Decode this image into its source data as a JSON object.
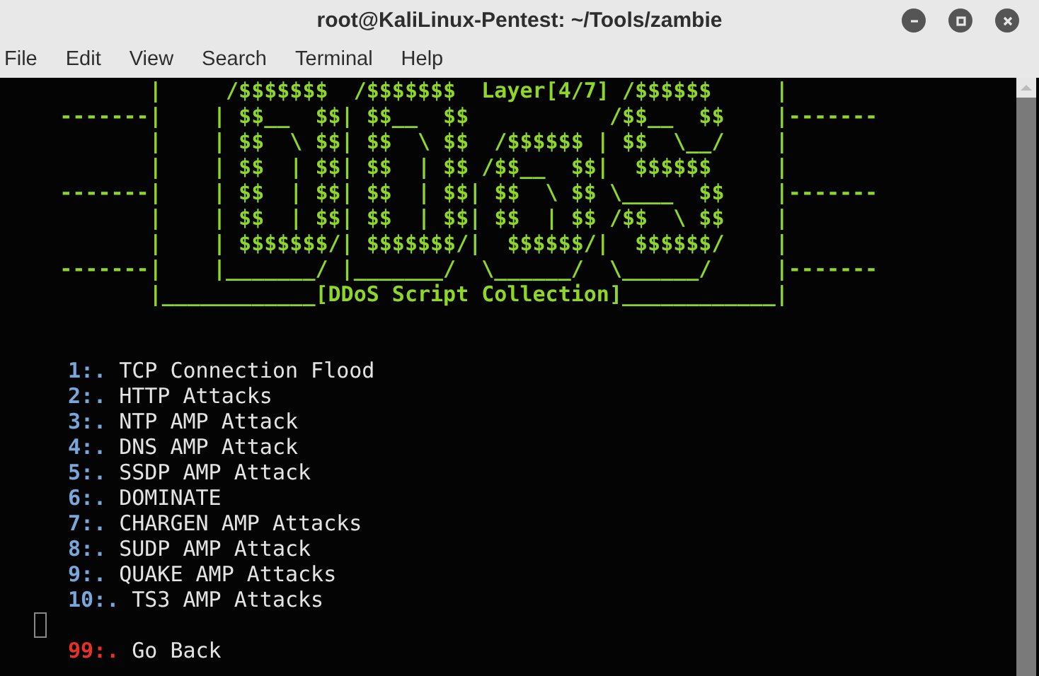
{
  "window": {
    "title": "root@KaliLinux-Pentest: ~/Tools/zambie"
  },
  "menu": [
    "File",
    "Edit",
    "View",
    "Search",
    "Terminal",
    "Help"
  ],
  "terminal": {
    "banner": [
      "           |     /$$$$$$$  /$$$$$$$  Layer[4/7] /$$$$$$     |",
      "    -------|    | $$__  $$| $$__  $$           /$$__  $$    |-------",
      "           |    | $$  \\ $$| $$  \\ $$  /$$$$$$ | $$  \\__/    |",
      "           |    | $$  | $$| $$  | $$ /$$__  $$|  $$$$$$     |",
      "    -------|    | $$  | $$| $$  | $$| $$  \\ $$ \\____  $$    |-------",
      "           |    | $$  | $$| $$  | $$| $$  | $$ /$$  \\ $$    |",
      "           |    | $$$$$$$/| $$$$$$$/|  $$$$$$/|  $$$$$$/    |",
      "    -------|    |_______/ |_______/  \\______/  \\______/     |-------",
      "           |____________[DDoS Script Collection]____________|"
    ],
    "options": [
      {
        "number": "1:.",
        "label": "TCP Connection Flood",
        "kind": "option"
      },
      {
        "number": "2:.",
        "label": "HTTP Attacks",
        "kind": "option"
      },
      {
        "number": "3:.",
        "label": "NTP AMP Attack",
        "kind": "option"
      },
      {
        "number": "4:.",
        "label": "DNS AMP Attack",
        "kind": "option"
      },
      {
        "number": "5:.",
        "label": "SSDP AMP Attack",
        "kind": "option"
      },
      {
        "number": "6:.",
        "label": "DOMINATE",
        "kind": "option"
      },
      {
        "number": "7:.",
        "label": "CHARGEN AMP Attacks",
        "kind": "option"
      },
      {
        "number": "8:.",
        "label": "SUDP AMP Attack",
        "kind": "option"
      },
      {
        "number": "9:.",
        "label": "QUAKE AMP Attacks",
        "kind": "option"
      },
      {
        "number": "10:.",
        "label": "TS3 AMP Attacks",
        "kind": "option"
      },
      {
        "number": "99:.",
        "label": "Go Back",
        "kind": "back"
      }
    ]
  }
}
